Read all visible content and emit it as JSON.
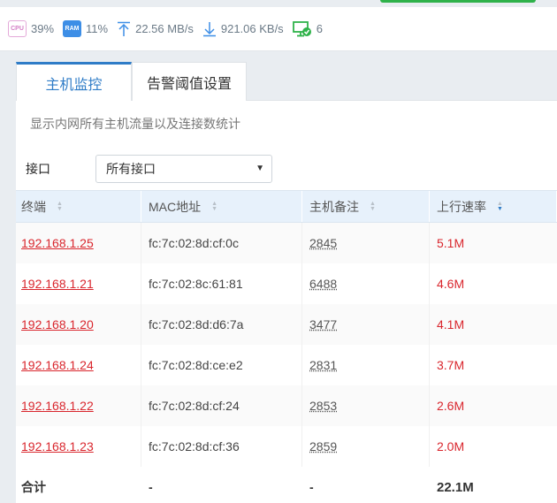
{
  "status": {
    "cpu": {
      "icon": "cpu-icon",
      "label": "CPU",
      "value": "39%"
    },
    "ram": {
      "icon": "ram-icon",
      "label": "RAM",
      "value": "11%"
    },
    "upload": {
      "icon": "upload-arrow-icon",
      "value": "22.56 MB/s"
    },
    "download": {
      "icon": "download-arrow-icon",
      "value": "921.06 KB/s"
    },
    "online": {
      "icon": "monitor-check-icon",
      "value": "6"
    },
    "colors": {
      "accent": "#2f7cc7",
      "danger": "#d9262d",
      "online": "#2fb24a"
    }
  },
  "tabs": [
    {
      "label": "主机监控",
      "active": true
    },
    {
      "label": "告警阈值设置",
      "active": false
    }
  ],
  "description": "显示内网所有主机流量以及连接数统计",
  "interface": {
    "label": "接口",
    "selected": "所有接口"
  },
  "table": {
    "headers": [
      "终端",
      "MAC地址",
      "主机备注",
      "上行速率"
    ],
    "sorted_column": "上行速率",
    "sort_direction": "desc",
    "rows": [
      {
        "ip": "192.168.1.25",
        "mac": "fc:7c:02:8d:cf:0c",
        "note": "2845",
        "rate": "5.1M"
      },
      {
        "ip": "192.168.1.21",
        "mac": "fc:7c:02:8c:61:81",
        "note": "6488",
        "rate": "4.6M"
      },
      {
        "ip": "192.168.1.20",
        "mac": "fc:7c:02:8d:d6:7a",
        "note": "3477",
        "rate": "4.1M"
      },
      {
        "ip": "192.168.1.24",
        "mac": "fc:7c:02:8d:ce:e2",
        "note": "2831",
        "rate": "3.7M"
      },
      {
        "ip": "192.168.1.22",
        "mac": "fc:7c:02:8d:cf:24",
        "note": "2853",
        "rate": "2.6M"
      },
      {
        "ip": "192.168.1.23",
        "mac": "fc:7c:02:8d:cf:36",
        "note": "2859",
        "rate": "2.0M"
      }
    ],
    "footer": {
      "label": "合计",
      "mac": "-",
      "note": "-",
      "rate": "22.1M"
    }
  }
}
